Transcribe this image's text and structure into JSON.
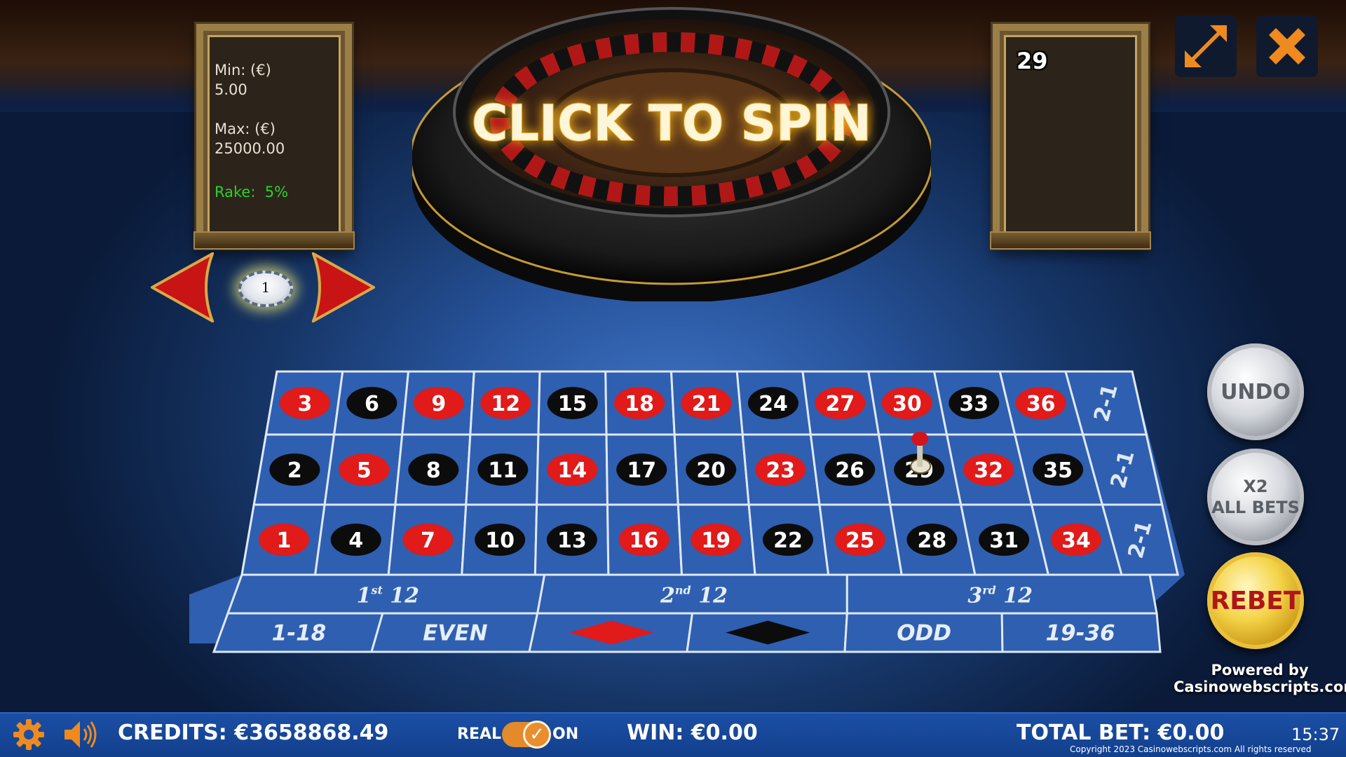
{
  "limits": {
    "min_label": "Min: (€)",
    "min_value": "5.00",
    "max_label": "Max: (€)",
    "max_value": "25000.00",
    "rake_label": "Rake:",
    "rake_value": "5%"
  },
  "last_result": "29",
  "wheel": {
    "spin_label": "CLICK TO SPIN"
  },
  "chip_selector": {
    "value": "1"
  },
  "table": {
    "numbers": {
      "row_top": [
        {
          "n": "3",
          "c": "red"
        },
        {
          "n": "6",
          "c": "black"
        },
        {
          "n": "9",
          "c": "red"
        },
        {
          "n": "12",
          "c": "red"
        },
        {
          "n": "15",
          "c": "black"
        },
        {
          "n": "18",
          "c": "red"
        },
        {
          "n": "21",
          "c": "red"
        },
        {
          "n": "24",
          "c": "black"
        },
        {
          "n": "27",
          "c": "red"
        },
        {
          "n": "30",
          "c": "red"
        },
        {
          "n": "33",
          "c": "black"
        },
        {
          "n": "36",
          "c": "red"
        }
      ],
      "row_mid": [
        {
          "n": "2",
          "c": "black"
        },
        {
          "n": "5",
          "c": "red"
        },
        {
          "n": "8",
          "c": "black"
        },
        {
          "n": "11",
          "c": "black"
        },
        {
          "n": "14",
          "c": "red"
        },
        {
          "n": "17",
          "c": "black"
        },
        {
          "n": "20",
          "c": "black"
        },
        {
          "n": "23",
          "c": "red"
        },
        {
          "n": "26",
          "c": "black"
        },
        {
          "n": "29",
          "c": "black"
        },
        {
          "n": "32",
          "c": "red"
        },
        {
          "n": "35",
          "c": "black"
        }
      ],
      "row_bot": [
        {
          "n": "1",
          "c": "red"
        },
        {
          "n": "4",
          "c": "black"
        },
        {
          "n": "7",
          "c": "red"
        },
        {
          "n": "10",
          "c": "black"
        },
        {
          "n": "13",
          "c": "black"
        },
        {
          "n": "16",
          "c": "red"
        },
        {
          "n": "19",
          "c": "red"
        },
        {
          "n": "22",
          "c": "black"
        },
        {
          "n": "25",
          "c": "red"
        },
        {
          "n": "28",
          "c": "black"
        },
        {
          "n": "31",
          "c": "black"
        },
        {
          "n": "34",
          "c": "red"
        }
      ]
    },
    "columns": [
      "2-1",
      "2-1",
      "2-1"
    ],
    "dozens": [
      {
        "ord": "1",
        "sup": "st",
        "num": "12"
      },
      {
        "ord": "2",
        "sup": "nd",
        "num": "12"
      },
      {
        "ord": "3",
        "sup": "rd",
        "num": "12"
      }
    ],
    "outside": [
      "1-18",
      "EVEN",
      "",
      "",
      "ODD",
      "19-36"
    ],
    "marker_on": "29"
  },
  "side_buttons": {
    "undo": "UNDO",
    "x2_line1": "X2",
    "x2_line2": "ALL BETS",
    "rebet": "REBET"
  },
  "powered": {
    "line1": "Powered by",
    "line2": "Casinowebscripts.com"
  },
  "bottom_bar": {
    "credits_label": "CREDITS:",
    "credits_value": "€3658868.49",
    "real_label": "REAL",
    "on_label": "ON",
    "win_label": "WIN:",
    "win_value": "€0.00",
    "total_bet_label": "TOTAL BET:",
    "total_bet_value": "€0.00",
    "clock": "15:37",
    "copyright": "Copyright 2023 Casinowebscripts.com All rights reserved"
  },
  "colors": {
    "red": "#e11a1a",
    "black": "#0c0c0c",
    "felt": "#2f5fb0",
    "gold": "#c6a35e",
    "toggle": "#e38a2a"
  },
  "icons": [
    "settings-gear-icon",
    "speaker-icon",
    "fullscreen-icon",
    "close-icon",
    "arrow-left-icon",
    "arrow-right-icon",
    "checkmark-icon"
  ]
}
